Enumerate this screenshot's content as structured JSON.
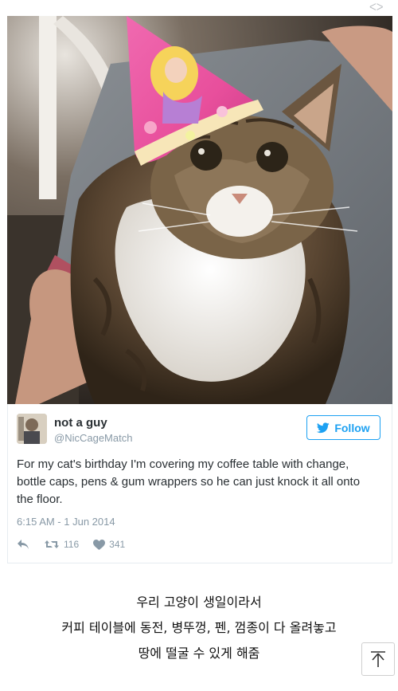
{
  "tweet": {
    "display_name": "not a guy",
    "handle": "@NicCageMatch",
    "follow_label": "Follow",
    "text": "For my cat's birthday I'm covering my coffee table with change, bottle caps, pens & gum wrappers so he can just knock it all onto the floor.",
    "timestamp": "6:15 AM - 1 Jun 2014",
    "retweet_count": "116",
    "like_count": "341"
  },
  "caption": {
    "lines": [
      "우리 고양이 생일이라서",
      "커피 테이블에 동전, 병뚜껑, 펜, 껌종이 다 올려놓고",
      "땅에 떨굴 수 있게 해줌"
    ]
  },
  "icons": {
    "reply": "reply-icon",
    "retweet": "retweet-icon",
    "like": "heart-icon",
    "follow": "twitter-bird-icon",
    "scroll_top": "arrow-up-icon"
  },
  "colors": {
    "accent": "#1da1f2",
    "muted": "#8899a6",
    "text": "#292f33"
  }
}
